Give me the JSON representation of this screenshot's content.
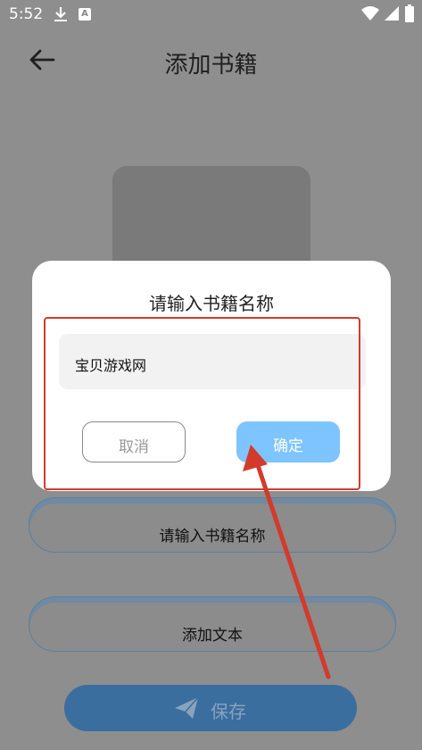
{
  "status_bar": {
    "time": "5:52",
    "a_badge": "A"
  },
  "header": {
    "title": "添加书籍"
  },
  "dialog": {
    "title": "请输入书籍名称",
    "input_value": "宝贝游戏网",
    "cancel_label": "取消",
    "confirm_label": "确定"
  },
  "background_buttons": {
    "name_label": "请输入书籍名称",
    "text_label": "添加文本",
    "save_label": "保存"
  },
  "colors": {
    "confirm": "#7ec4ff",
    "save": "#3a6e9f",
    "annotation": "#d23b2b"
  },
  "icons": [
    "download-icon",
    "a-badge-icon",
    "wifi-icon",
    "signal-icon",
    "battery-icon",
    "back-arrow-icon",
    "send-icon"
  ]
}
